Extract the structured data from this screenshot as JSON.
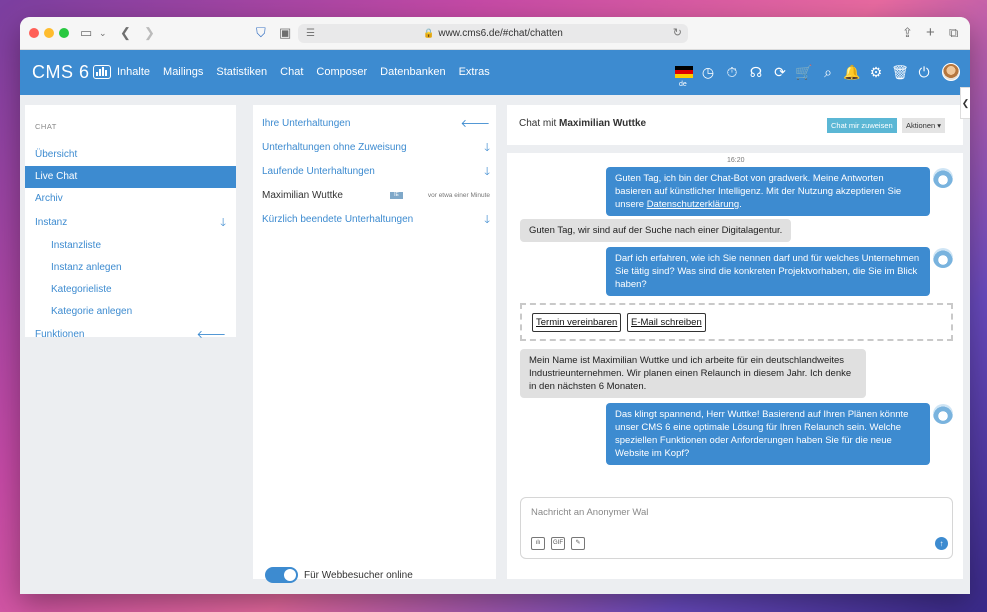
{
  "browser": {
    "url": "www.cms6.de/#chat/chatten",
    "icons": [
      "sidebar-icon",
      "chevron-down-icon",
      "back-icon",
      "forward-icon",
      "shield-icon",
      "tabs-icon",
      "page-icon",
      "reload-icon",
      "share-icon",
      "new-tab-icon",
      "tab-overview-icon"
    ]
  },
  "app": {
    "logo_text": "CMS 6",
    "nav": [
      "Inhalte",
      "Mailings",
      "Statistiken",
      "Chat",
      "Composer",
      "Datenbanken",
      "Extras"
    ],
    "lang": "de",
    "accent": "#3d8bd0"
  },
  "sidebar": {
    "heading": "CHAT",
    "items": [
      {
        "label": "Übersicht"
      },
      {
        "label": "Live Chat",
        "active": true
      },
      {
        "label": "Archiv"
      },
      {
        "label": "Instanz"
      },
      {
        "label": "Instanzliste"
      },
      {
        "label": "Instanz anlegen"
      },
      {
        "label": "Kategorieliste"
      },
      {
        "label": "Kategorie anlegen"
      },
      {
        "label": "Funktionen"
      }
    ]
  },
  "conversations": {
    "groups": [
      {
        "label": "Ihre Unterhaltungen"
      },
      {
        "label": "Unterhaltungen ohne Zuweisung"
      },
      {
        "label": "Laufende Unterhaltungen"
      },
      {
        "label": "Kürzlich beendete Unterhaltungen"
      }
    ],
    "running_user": {
      "name": "Maximilian Wuttke",
      "tag": "IE",
      "time": "vor etwa einer Minute"
    },
    "toggle_label": "Für Webbesucher online",
    "toggle_on": true
  },
  "chat": {
    "title_prefix": "Chat mit",
    "title_name": "Maximilian Wuttke",
    "assign_button": "Chat mir zuweisen",
    "actions_button": "Aktionen ▾",
    "time": "16:20",
    "msg1_a": "Guten Tag, ich bin der Chat-Bot von gradwerk. Meine Antworten basieren auf künstlicher Intelligenz. Mit der Nutzung akzeptieren Sie unsere ",
    "msg1_link": "Datenschutzerklärung",
    "msg1_b": ".",
    "msg2": "Guten Tag, wir sind auf der Suche nach einer Digitalagentur.",
    "msg3": "Darf ich erfahren, wie ich Sie nennen darf und für welches Unternehmen Sie tätig sind? Was sind die konkreten Projektvorhaben, die Sie im Blick haben?",
    "chip1": "Termin vereinbaren",
    "chip2": "E-Mail schreiben",
    "msg4": "Mein Name ist Maximilian Wuttke und ich arbeite für ein deutschlandweites Industrieunternehmen. Wir planen einen Relaunch in diesem Jahr. Ich denke in den nächsten 6 Monaten.",
    "msg5": "Das klingt spannend, Herr Wuttke! Basierend auf Ihren Plänen könnte unser CMS 6 eine optimale Lösung für Ihren Relaunch sein. Welche speziellen Funktionen oder Anforderungen haben Sie für die neue Website im Kopf?",
    "input_placeholder": "Nachricht an Anonymer Wal",
    "tool_gif": "GIF"
  }
}
